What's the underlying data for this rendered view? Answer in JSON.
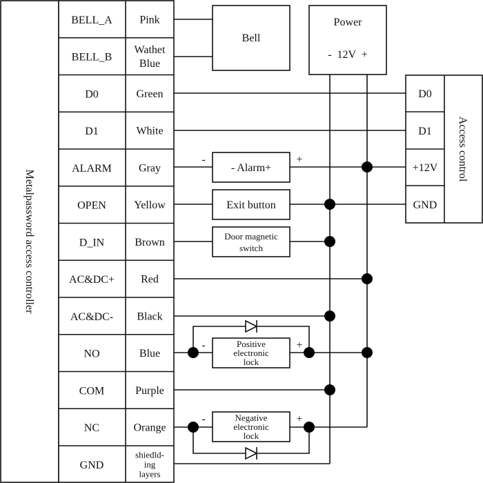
{
  "controller": {
    "label": "Metalpassword access controller"
  },
  "terminals": [
    {
      "terminal": "BELL_A",
      "color": [
        "Pink"
      ]
    },
    {
      "terminal": "BELL_B",
      "color": [
        "Wathet",
        "Blue"
      ]
    },
    {
      "terminal": "D0",
      "color": [
        "Green"
      ]
    },
    {
      "terminal": "D1",
      "color": [
        "White"
      ]
    },
    {
      "terminal": "ALARM",
      "color": [
        "Gray"
      ]
    },
    {
      "terminal": "OPEN",
      "color": [
        "Yellow"
      ]
    },
    {
      "terminal": "D_IN",
      "color": [
        "Brown"
      ]
    },
    {
      "terminal": "AC&DC+",
      "color": [
        "Red"
      ]
    },
    {
      "terminal": "AC&DC-",
      "color": [
        "Black"
      ]
    },
    {
      "terminal": "NO",
      "color": [
        "Blue"
      ]
    },
    {
      "terminal": "COM",
      "color": [
        "Purple"
      ]
    },
    {
      "terminal": "NC",
      "color": [
        "Orange"
      ]
    },
    {
      "terminal": "GND",
      "color": [
        "shiedld-",
        "ing",
        "layers"
      ]
    }
  ],
  "bell": {
    "label": "Bell"
  },
  "power": {
    "label": "Power",
    "voltage": "-  12V  +"
  },
  "alarm": {
    "label": "- Alarm+",
    "minus": "-",
    "plus": "+"
  },
  "exit_button": {
    "label": "Exit button"
  },
  "door_switch": {
    "lines": [
      "Door magnetic",
      "switch"
    ]
  },
  "positive_lock": {
    "lines": [
      "Positive",
      "electronic",
      "lock"
    ],
    "minus": "-",
    "plus": "+"
  },
  "negative_lock": {
    "lines": [
      "Negative",
      "electronic",
      "lock"
    ],
    "minus": "-",
    "plus": "+"
  },
  "access_control": {
    "label": "Access control",
    "pins": [
      "D0",
      "D1",
      "+12V",
      "GND"
    ]
  }
}
